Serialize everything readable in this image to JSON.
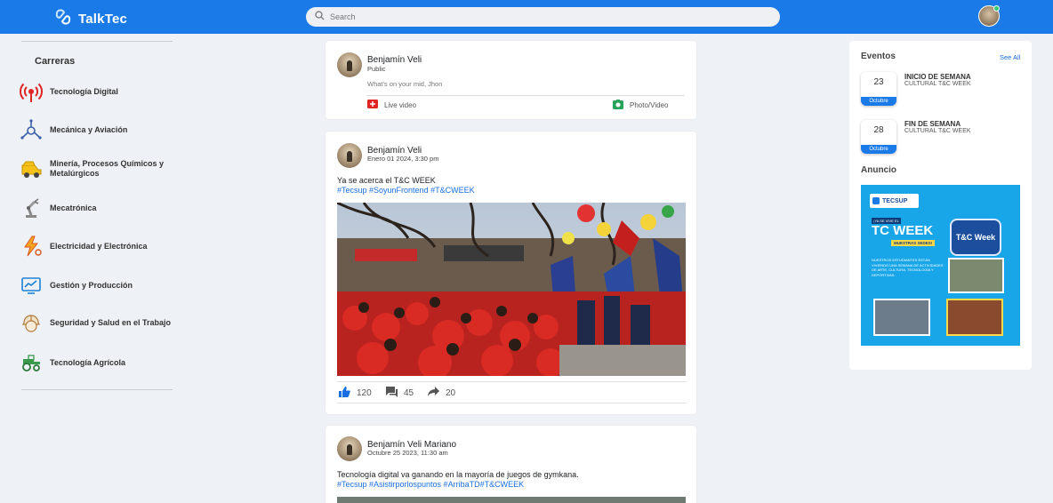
{
  "header": {
    "app_name": "TalkTec",
    "search_placeholder": "Search"
  },
  "sidebar": {
    "title": "Carreras",
    "items": [
      {
        "label": "Tecnología Digital",
        "icon": "wifi-antenna-icon"
      },
      {
        "label": "Mecánica y Aviación",
        "icon": "aircraft-icon"
      },
      {
        "label": "Minería, Procesos Químicos y Metalúrgicos",
        "icon": "mining-truck-icon"
      },
      {
        "label": "Mecatrónica",
        "icon": "robot-arm-icon"
      },
      {
        "label": "Electricidad y Electrónica",
        "icon": "lightning-icon"
      },
      {
        "label": "Gestión y Producción",
        "icon": "chart-monitor-icon"
      },
      {
        "label": "Seguridad y Salud en el Trabajo",
        "icon": "hard-hat-icon"
      },
      {
        "label": "Tecnología Agrícola",
        "icon": "tractor-icon"
      }
    ]
  },
  "composer": {
    "user": "Benjamín Veli",
    "visibility": "Public",
    "placeholder": "What's on your mid, Jhon",
    "live_label": "Live video",
    "photo_label": "Photo/Video"
  },
  "posts": [
    {
      "user": "Benjamín Veli",
      "date": "Enero 01 2024, 3:30 pm",
      "text": "Ya se acerca el T&C WEEK",
      "tags": "#Tecsup #SoyunFrontend #T&CWEEK",
      "likes": "120",
      "comments": "45",
      "shares": "20"
    },
    {
      "user": "Benjamín Veli Mariano",
      "date": "Octubre 25 2023, 11:30 am",
      "text": "Tecnología digital va ganando en la mayoría de juegos de gymkana.",
      "tags": "#Tecsup #Asistirporlospuntos #ArribaTD#T&CWEEK"
    }
  ],
  "events": {
    "title": "Eventos",
    "see_all": "See All",
    "items": [
      {
        "day": "23",
        "month": "Octubre",
        "title": "INICIO DE SEMANA",
        "subtitle": "CULTURAL T&C WEEK"
      },
      {
        "day": "28",
        "month": "Octubre",
        "title": "FIN DE SEMANA",
        "subtitle": "CULTURAL T&C WEEK"
      }
    ]
  },
  "ads": {
    "title": "Anuncio",
    "brand": "TECSUP",
    "tagline": "¡YA SE VIVE EL",
    "headline": "TC WEEK",
    "sub": "MUESTRAS SEDES!",
    "badge": "T&C Week",
    "body": "NUESTROS ESTUDIANTES ESTÁN VIVIENDO UNA SEMANA DE ACTIVIDADES DE ARTE, CULTURA, TECNOLOGÍA Y DEPORTIVAS."
  },
  "colors": {
    "primary": "#1a7ae8",
    "link": "#1a6fe0",
    "background": "#eef1f6"
  }
}
